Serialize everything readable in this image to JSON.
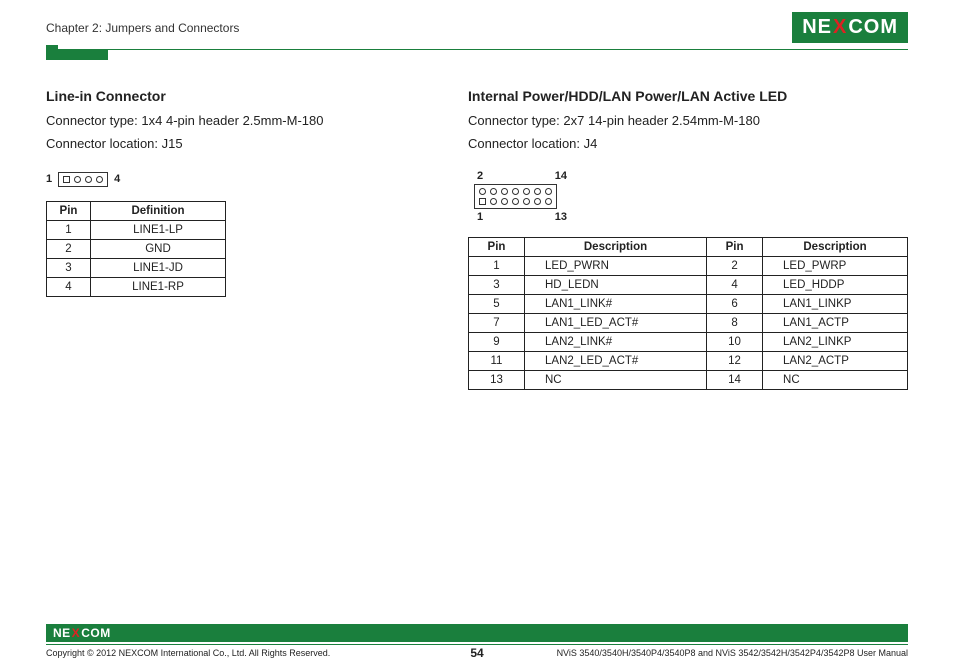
{
  "header": {
    "chapter": "Chapter 2: Jumpers and Connectors",
    "logo_text_1": "NE",
    "logo_x": "X",
    "logo_text_2": "COM"
  },
  "left": {
    "title": "Line-in Connector",
    "spec1": "Connector type: 1x4 4-pin header 2.5mm-M-180",
    "spec2": "Connector location: J15",
    "pin_label_left": "1",
    "pin_label_right": "4",
    "table": {
      "headers": [
        "Pin",
        "Definition"
      ],
      "rows": [
        [
          "1",
          "LINE1-LP"
        ],
        [
          "2",
          "GND"
        ],
        [
          "3",
          "LINE1-JD"
        ],
        [
          "4",
          "LINE1-RP"
        ]
      ]
    }
  },
  "right": {
    "title": "Internal Power/HDD/LAN Power/LAN Active LED",
    "spec1": "Connector type: 2x7 14-pin header 2.54mm-M-180",
    "spec2": "Connector location: J4",
    "pins": {
      "tl": "2",
      "tr": "14",
      "bl": "1",
      "br": "13"
    },
    "table": {
      "headers": [
        "Pin",
        "Description",
        "Pin",
        "Description"
      ],
      "rows": [
        [
          "1",
          "LED_PWRN",
          "2",
          "LED_PWRP"
        ],
        [
          "3",
          "HD_LEDN",
          "4",
          "LED_HDDP"
        ],
        [
          "5",
          "LAN1_LINK#",
          "6",
          "LAN1_LINKP"
        ],
        [
          "7",
          "LAN1_LED_ACT#",
          "8",
          "LAN1_ACTP"
        ],
        [
          "9",
          "LAN2_LINK#",
          "10",
          "LAN2_LINKP"
        ],
        [
          "11",
          "LAN2_LED_ACT#",
          "12",
          "LAN2_ACTP"
        ],
        [
          "13",
          "NC",
          "14",
          "NC"
        ]
      ]
    }
  },
  "footer": {
    "copyright": "Copyright © 2012 NEXCOM International Co., Ltd. All Rights Reserved.",
    "page": "54",
    "manual": "NViS 3540/3540H/3540P4/3540P8 and NViS 3542/3542H/3542P4/3542P8 User Manual"
  }
}
